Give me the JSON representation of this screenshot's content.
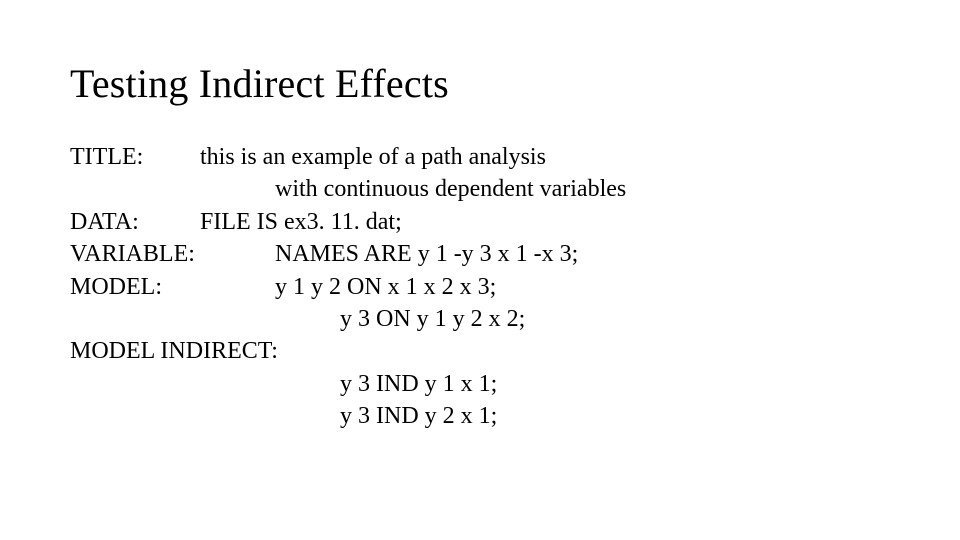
{
  "heading": "Testing Indirect Effects",
  "lines": [
    {
      "indent": 0,
      "label": "TITLE:",
      "labelCols": 1,
      "text": "this is an example of a path analysis"
    },
    {
      "indent": 2,
      "label": "",
      "labelCols": 0,
      "text": "with continuous dependent variables"
    },
    {
      "indent": 0,
      "label": "DATA:",
      "labelCols": 1,
      "text": "FILE IS ex3. 11. dat;"
    },
    {
      "indent": 0,
      "label": "VARIABLE:",
      "labelCols": 2,
      "text": "NAMES ARE y 1 -y 3 x 1 -x 3;"
    },
    {
      "indent": 0,
      "label": "MODEL:",
      "labelCols": 2,
      "text": "y 1 y 2 ON x 1 x 2 x 3;"
    },
    {
      "indent": 3,
      "label": "",
      "labelCols": 0,
      "text": "y 3 ON y 1 y 2 x 2;"
    },
    {
      "indent": 0,
      "label": "MODEL INDIRECT:",
      "labelCols": 3,
      "text": ""
    },
    {
      "indent": 3,
      "label": "",
      "labelCols": 0,
      "text": "y 3 IND y 1 x 1;"
    },
    {
      "indent": 3,
      "label": "",
      "labelCols": 0,
      "text": "y 3 IND y 2 x 1;"
    }
  ]
}
